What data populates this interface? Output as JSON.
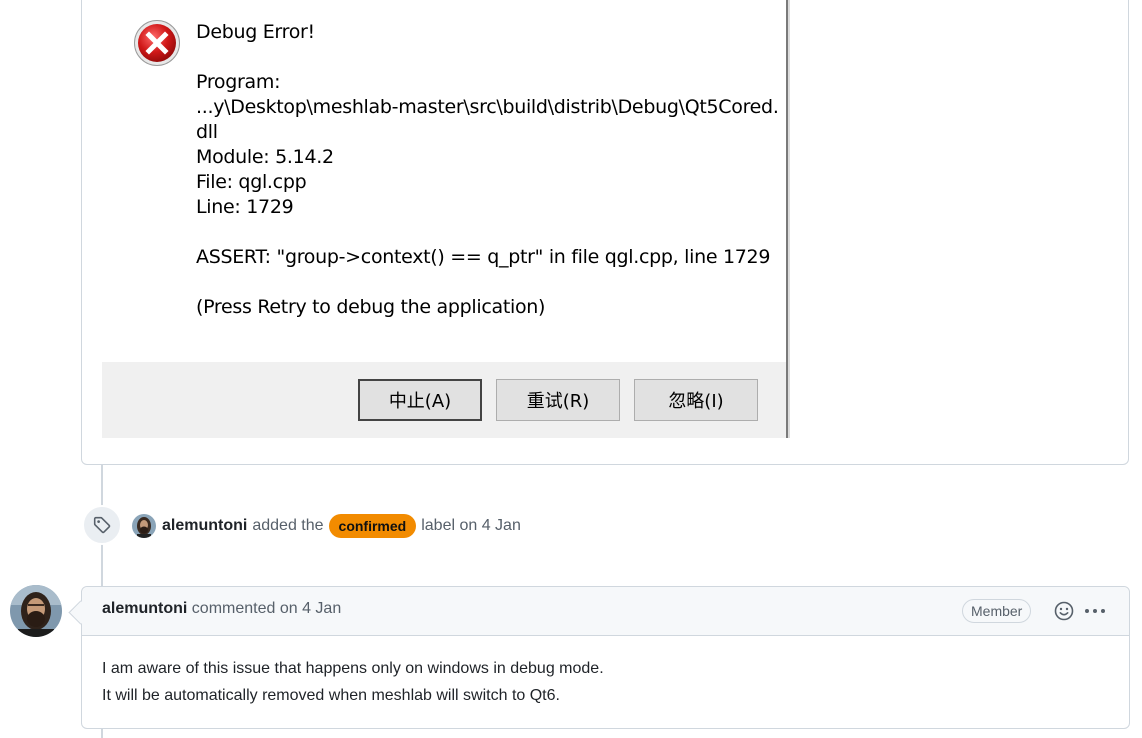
{
  "dialog": {
    "title": "Debug Error!",
    "lines": [
      "Program:",
      "...y\\Desktop\\meshlab-master\\src\\build\\distrib\\Debug\\Qt5Cored.",
      "dll",
      "Module: 5.14.2",
      "File: qgl.cpp",
      "Line: 1729"
    ],
    "assert_text": "ASSERT: \"group->context() == q_ptr\" in file qgl.cpp, line 1729",
    "hint": "(Press Retry to debug the application)",
    "buttons": [
      "中止(A)",
      "重试(R)",
      "忽略(I)"
    ]
  },
  "event": {
    "icon": "tag-icon",
    "user": "alemuntoni",
    "action": "added the",
    "label": "confirmed",
    "label_color": "#f28b00",
    "suffix": "label on 4 Jan"
  },
  "comment": {
    "author": "alemuntoni",
    "meta": "commented on 4 Jan",
    "role": "Member",
    "body": [
      "I am aware of this issue that happens only on windows in debug mode.",
      "It will be automatically removed when meshlab will switch to Qt6."
    ]
  }
}
